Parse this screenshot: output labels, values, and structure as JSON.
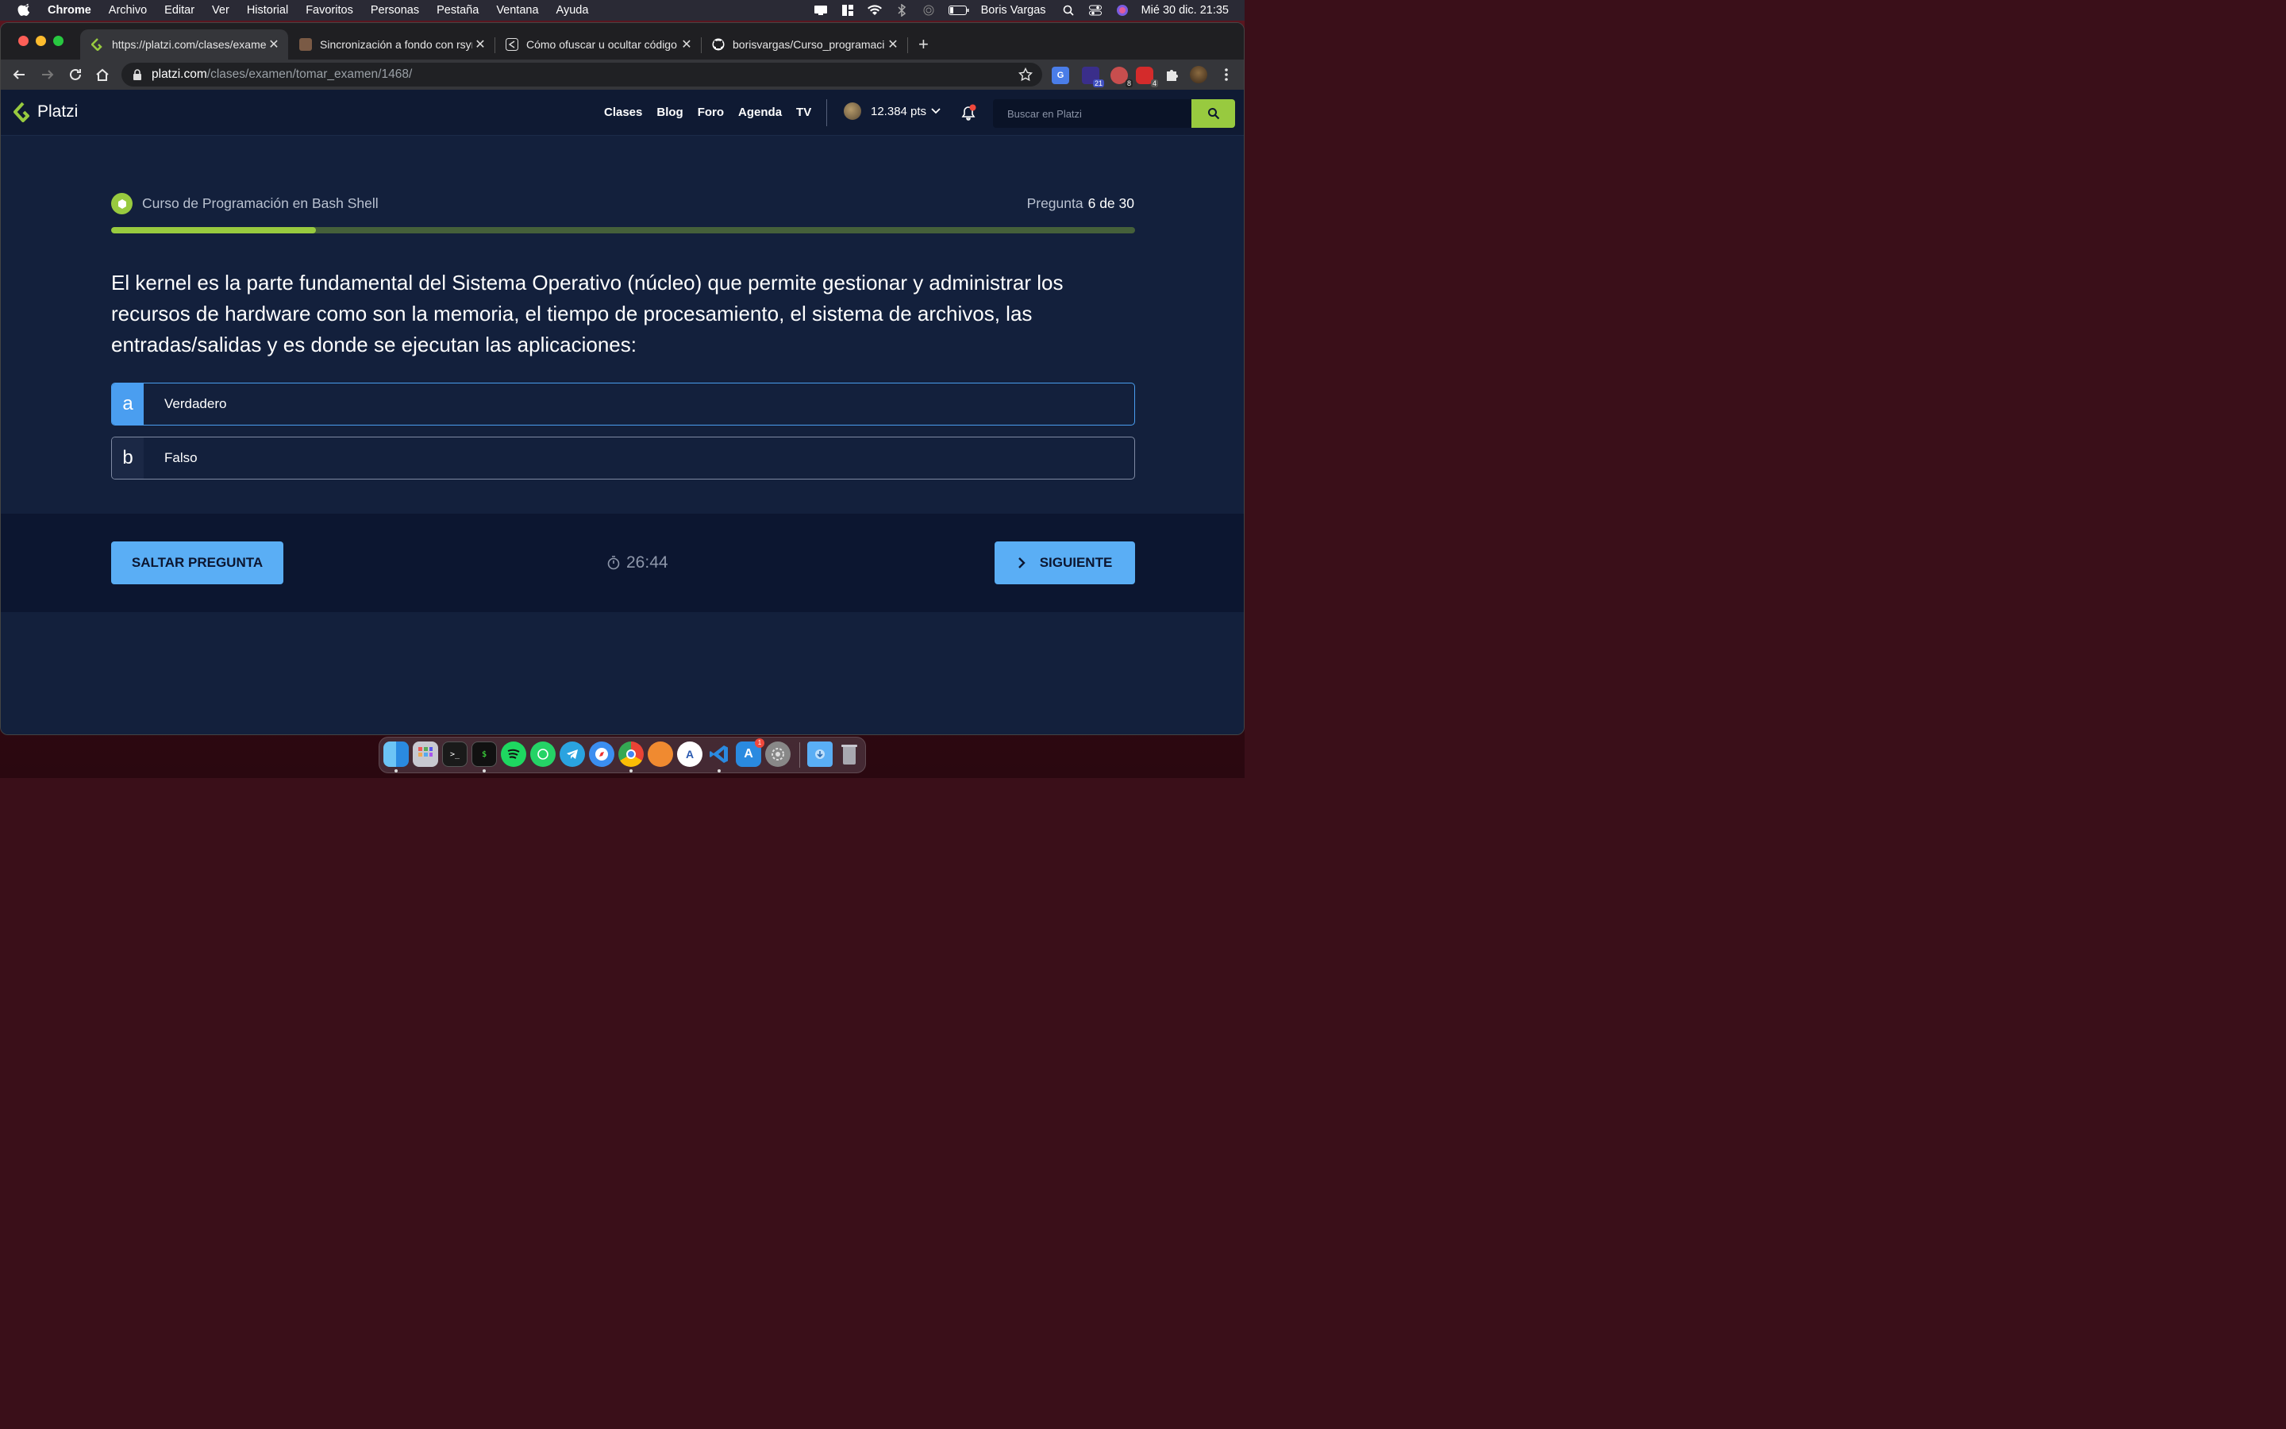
{
  "menubar": {
    "app": "Chrome",
    "items": [
      "Archivo",
      "Editar",
      "Ver",
      "Historial",
      "Favoritos",
      "Personas",
      "Pestaña",
      "Ventana",
      "Ayuda"
    ],
    "user": "Boris Vargas",
    "datetime": "Mié 30 dic.  21:35"
  },
  "tabs": [
    {
      "title": "https://platzi.com/clases/examen/",
      "icon": "platzi-icon",
      "active": true
    },
    {
      "title": "Sincronización a fondo con rsync",
      "icon": "avatar-icon",
      "active": false
    },
    {
      "title": "Cómo ofuscar u ocultar código",
      "icon": "share-icon",
      "active": false
    },
    {
      "title": "borisvargas/Curso_programacion",
      "icon": "github-icon",
      "active": false
    }
  ],
  "address": {
    "host": "platzi.com",
    "path": "/clases/examen/tomar_examen/1468/"
  },
  "extensions": [
    {
      "name": "translate-extension-icon",
      "badge": ""
    },
    {
      "name": "extension-21-icon",
      "badge": "21"
    },
    {
      "name": "extension-8-icon",
      "badge": "8"
    },
    {
      "name": "extension-4-icon",
      "badge": "4"
    }
  ],
  "platzi": {
    "logo_text": "Platzi",
    "nav": [
      "Clases",
      "Blog",
      "Foro",
      "Agenda",
      "TV"
    ],
    "points": "12.384 pts",
    "search_placeholder": "Buscar en Platzi"
  },
  "exam": {
    "course": "Curso de Programación en Bash Shell",
    "question_label": "Pregunta",
    "question_num": "6 de 30",
    "progress": 0.2,
    "question": "El kernel es la parte fundamental del Sistema Operativo (núcleo) que permite gestionar y administrar los recursos de hardware como son la memoria, el tiempo de procesamiento, el sistema de archivos, las entradas/salidas y es donde se ejecutan las aplicaciones:",
    "options": [
      {
        "letter": "a",
        "text": "Verdadero",
        "selected": true
      },
      {
        "letter": "b",
        "text": "Falso",
        "selected": false
      }
    ],
    "skip_label": "SALTAR PREGUNTA",
    "timer": "26:44",
    "next_label": "SIGUIENTE"
  },
  "colors": {
    "accent_green": "#98ca3f",
    "accent_blue": "#5aaef5",
    "page_bg": "#13203c"
  },
  "dock": [
    "finder",
    "launchpad",
    "terminal",
    "iterm",
    "spotify",
    "whatsapp",
    "telegram",
    "safari",
    "chrome",
    "sketch",
    "app",
    "vscode",
    "app-store",
    "system-preferences",
    "downloads",
    "trash"
  ]
}
